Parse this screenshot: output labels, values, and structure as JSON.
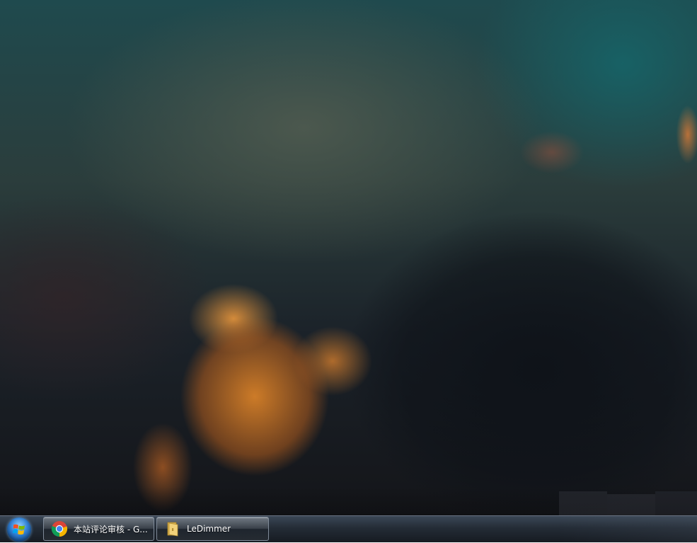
{
  "desktop": {
    "wallpaper": "sunset-clouds"
  },
  "taskbar": {
    "start_button": {
      "icon": "windows-logo-icon"
    },
    "items": [
      {
        "label": "本站评论审核 - G...",
        "icon": "chrome-icon",
        "active": true
      },
      {
        "label": "LeDimmer",
        "icon": "folder-icon",
        "active": false
      }
    ]
  },
  "colors": {
    "taskbar_top": "#3b4756",
    "taskbar_bottom": "#161b22",
    "orb_blue": "#2f7fd4",
    "chrome_red": "#db4437",
    "chrome_green": "#0f9d58",
    "chrome_yellow": "#f4b400",
    "chrome_blue": "#4285f4",
    "folder_yellow": "#f2d27a"
  }
}
